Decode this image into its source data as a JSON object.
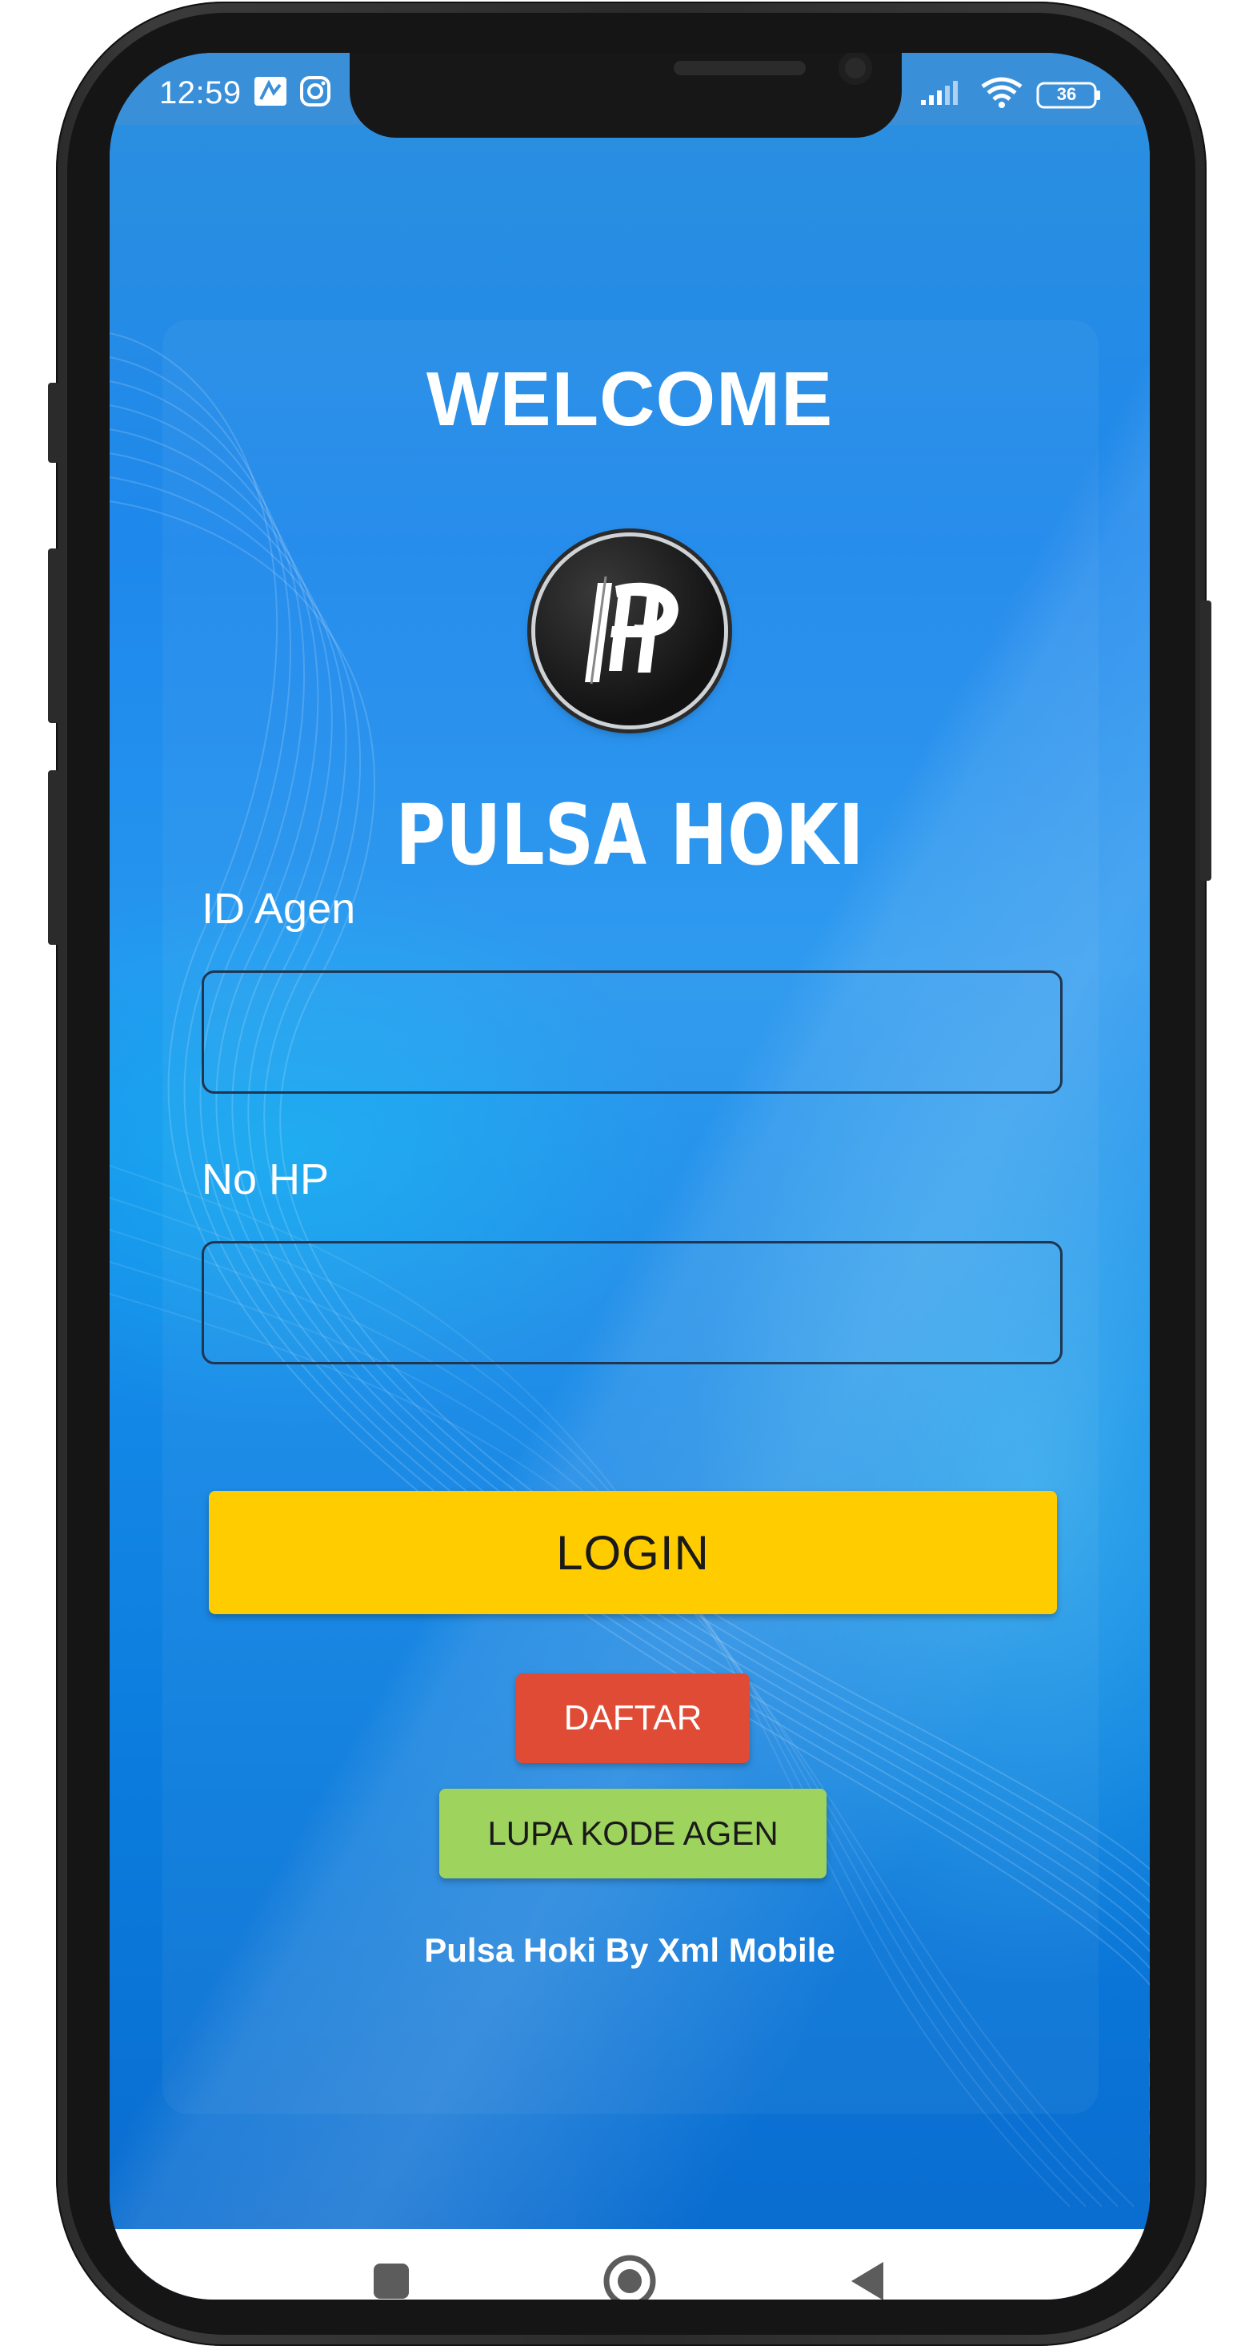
{
  "status_bar": {
    "time": "12:59",
    "battery": "36"
  },
  "login_screen": {
    "welcome": "WELCOME",
    "brand": "PULSA HOKI",
    "id_label": "ID Agen",
    "id_value": "",
    "hp_label": "No HP",
    "hp_value": "",
    "login_button": "LOGIN",
    "daftar_button": "DAFTAR",
    "lupa_button": "LUPA KODE AGEN",
    "credit": "Pulsa Hoki By Xml Mobile"
  },
  "navigation": {
    "recent_icon": "square-recents-icon",
    "home_icon": "circle-home-icon",
    "back_icon": "triangle-back-icon"
  },
  "colors": {
    "login_button": "#ffcc00",
    "daftar_button": "#e04b36",
    "lupa_button": "#9ed45e",
    "background": "#1e88ec"
  }
}
